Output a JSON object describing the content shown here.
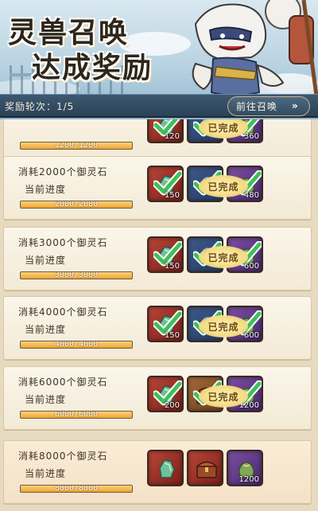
{
  "banner": {
    "title_line1": "灵兽召唤",
    "title_line2": "达成奖励",
    "round_label": "奖励轮次：1/5",
    "summon_button": "前往召唤",
    "summon_icon": "double-chevron-right-icon"
  },
  "rows": [
    {
      "title": "",
      "progress_label": "",
      "progress_text": "1200/1200",
      "progress": 1.0,
      "stamp": "已完成",
      "rewards": [
        {
          "icon": "jade-stone-icon",
          "qty": "120",
          "color": "red",
          "claimed": true
        },
        {
          "icon": "shikigami-piece-icon",
          "qty": "",
          "color": "blue",
          "claimed": true
        },
        {
          "icon": "pouch-icon",
          "qty": "360",
          "color": "purple",
          "claimed": true
        }
      ]
    },
    {
      "title": "消耗2000个御灵石",
      "progress_label": "当前进度",
      "progress_text": "2000/2000",
      "progress": 1.0,
      "stamp": "已完成",
      "rewards": [
        {
          "icon": "jade-stone-icon",
          "qty": "150",
          "color": "red",
          "claimed": true
        },
        {
          "icon": "shikigami-piece-icon",
          "qty": "",
          "color": "blue",
          "claimed": true
        },
        {
          "icon": "pouch-icon",
          "qty": "480",
          "color": "purple",
          "claimed": true
        }
      ]
    },
    {
      "title": "消耗3000个御灵石",
      "progress_label": "当前进度",
      "progress_text": "3000/3000",
      "progress": 1.0,
      "stamp": "已完成",
      "rewards": [
        {
          "icon": "jade-stone-icon",
          "qty": "150",
          "color": "red",
          "claimed": true
        },
        {
          "icon": "shikigami-piece-icon",
          "qty": "",
          "color": "blue",
          "claimed": true
        },
        {
          "icon": "pouch-icon",
          "qty": "600",
          "color": "purple",
          "claimed": true
        }
      ]
    },
    {
      "title": "消耗4000个御灵石",
      "progress_label": "当前进度",
      "progress_text": "4000/4000",
      "progress": 1.0,
      "stamp": "已完成",
      "rewards": [
        {
          "icon": "jade-stone-icon",
          "qty": "150",
          "color": "red",
          "claimed": true
        },
        {
          "icon": "shikigami-piece-icon",
          "qty": "",
          "color": "blue",
          "claimed": true
        },
        {
          "icon": "pouch-icon",
          "qty": "600",
          "color": "purple",
          "claimed": true
        }
      ]
    },
    {
      "title": "消耗6000个御灵石",
      "progress_label": "当前进度",
      "progress_text": "6000/6000",
      "progress": 1.0,
      "stamp": "已完成",
      "rewards": [
        {
          "icon": "jade-stone-icon",
          "qty": "200",
          "color": "red",
          "claimed": true
        },
        {
          "icon": "treasure-chest-icon",
          "qty": "",
          "color": "brown",
          "claimed": true
        },
        {
          "icon": "pouch-icon",
          "qty": "1200",
          "color": "purple",
          "claimed": true
        }
      ]
    },
    {
      "title": "消耗8000个御灵石",
      "progress_label": "当前进度",
      "progress_text": "8000/8000",
      "progress": 1.0,
      "stamp": "",
      "rewards": [
        {
          "icon": "jade-stone-icon",
          "qty": "",
          "color": "red",
          "claimed": false
        },
        {
          "icon": "treasure-chest-icon",
          "qty": "",
          "color": "red",
          "claimed": false
        },
        {
          "icon": "pouch-icon",
          "qty": "1200",
          "color": "purple",
          "claimed": false
        }
      ]
    }
  ]
}
